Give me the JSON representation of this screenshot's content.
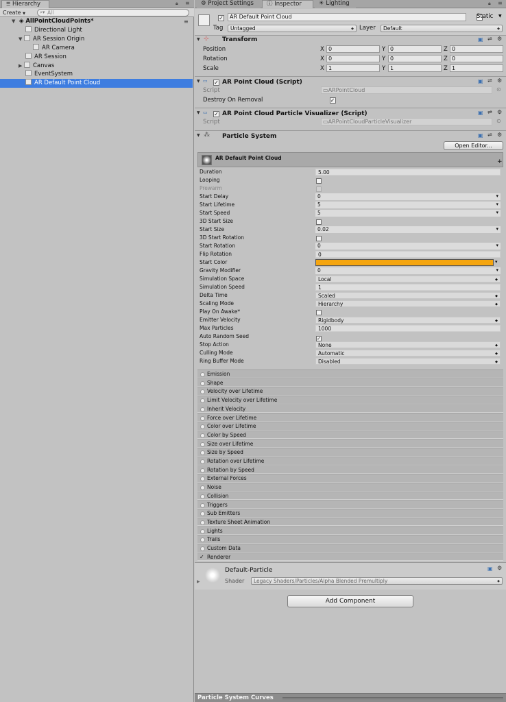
{
  "hierarchy": {
    "tab_label": "Hierarchy",
    "create_label": "Create",
    "search_placeholder": "All",
    "scene_name": "AllPointCloudPoints*",
    "items": [
      {
        "label": "Directional Light"
      },
      {
        "label": "AR Session Origin"
      },
      {
        "label": "AR Camera"
      },
      {
        "label": "AR Session"
      },
      {
        "label": "Canvas"
      },
      {
        "label": "EventSystem"
      },
      {
        "label": "AR Default Point Cloud"
      }
    ]
  },
  "tabs": {
    "project_settings": "Project Settings",
    "inspector": "Inspector",
    "lighting": "Lighting"
  },
  "object": {
    "name": "AR Default Point Cloud",
    "static_label": "Static",
    "tag_label": "Tag",
    "tag_value": "Untagged",
    "layer_label": "Layer",
    "layer_value": "Default"
  },
  "transform": {
    "title": "Transform",
    "rows": [
      {
        "label": "Position",
        "x": "0",
        "y": "0",
        "z": "0"
      },
      {
        "label": "Rotation",
        "x": "0",
        "y": "0",
        "z": "0"
      },
      {
        "label": "Scale",
        "x": "1",
        "y": "1",
        "z": "1"
      }
    ],
    "axis_x": "X",
    "axis_y": "Y",
    "axis_z": "Z"
  },
  "point_cloud": {
    "title": "AR Point Cloud (Script)",
    "script_label": "Script",
    "script_value": "ARPointCloud",
    "destroy_label": "Destroy On Removal"
  },
  "visualizer": {
    "title": "AR Point Cloud Particle Visualizer (Script)",
    "script_label": "Script",
    "script_value": "ARPointCloudParticleVisualizer"
  },
  "particle_system": {
    "title": "Particle System",
    "open_editor": "Open Editor...",
    "main_title": "AR Default Point Cloud",
    "plus": "+",
    "start_color": "#f5a50f",
    "props": [
      {
        "label": "Duration",
        "value": "5.00",
        "kind": "flat"
      },
      {
        "label": "Looping",
        "value": "",
        "kind": "check"
      },
      {
        "label": "Prewarm",
        "value": "",
        "kind": "check-dim"
      },
      {
        "label": "Start Delay",
        "value": "0",
        "kind": "dda"
      },
      {
        "label": "Start Lifetime",
        "value": "5",
        "kind": "dda"
      },
      {
        "label": "Start Speed",
        "value": "5",
        "kind": "dda"
      },
      {
        "label": "3D Start Size",
        "value": "",
        "kind": "check"
      },
      {
        "label": "Start Size",
        "value": "0.02",
        "kind": "dda"
      },
      {
        "label": "3D Start Rotation",
        "value": "",
        "kind": "check"
      },
      {
        "label": "Start Rotation",
        "value": "0",
        "kind": "dda"
      },
      {
        "label": "Flip Rotation",
        "value": "0",
        "kind": "flat"
      },
      {
        "label": "Start Color",
        "value": "",
        "kind": "color"
      },
      {
        "label": "Gravity Modifier",
        "value": "0",
        "kind": "dda"
      },
      {
        "label": "Simulation Space",
        "value": "Local",
        "kind": "ddb"
      },
      {
        "label": "Simulation Speed",
        "value": "1",
        "kind": "flat"
      },
      {
        "label": "Delta Time",
        "value": "Scaled",
        "kind": "ddb"
      },
      {
        "label": "Scaling Mode",
        "value": "Hierarchy",
        "kind": "ddb"
      },
      {
        "label": "Play On Awake*",
        "value": "",
        "kind": "check"
      },
      {
        "label": "Emitter Velocity",
        "value": "Rigidbody",
        "kind": "ddb"
      },
      {
        "label": "Max Particles",
        "value": "1000",
        "kind": "flat"
      },
      {
        "label": "Auto Random Seed",
        "value": "",
        "kind": "check-on"
      },
      {
        "label": "Stop Action",
        "value": "None",
        "kind": "ddb"
      },
      {
        "label": "Culling Mode",
        "value": "Automatic",
        "kind": "ddb"
      },
      {
        "label": "Ring Buffer Mode",
        "value": "Disabled",
        "kind": "ddb"
      }
    ],
    "modules": [
      "Emission",
      "Shape",
      "Velocity over Lifetime",
      "Limit Velocity over Lifetime",
      "Inherit Velocity",
      "Force over Lifetime",
      "Color over Lifetime",
      "Color by Speed",
      "Size over Lifetime",
      "Size by Speed",
      "Rotation over Lifetime",
      "Rotation by Speed",
      "External Forces",
      "Noise",
      "Collision",
      "Triggers",
      "Sub Emitters",
      "Texture Sheet Animation",
      "Lights",
      "Trails",
      "Custom Data",
      "Renderer"
    ]
  },
  "material": {
    "name": "Default-Particle",
    "shader_label": "Shader",
    "shader_value": "Legacy Shaders/Particles/Alpha Blended Premultiply"
  },
  "add_component": "Add Component",
  "curves_label": "Particle System Curves"
}
